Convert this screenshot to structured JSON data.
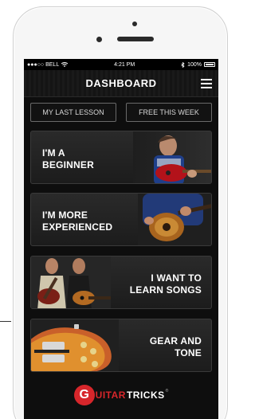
{
  "status_bar": {
    "carrier": "●●●○○ BELL",
    "time": "4:21 PM",
    "battery": "100%"
  },
  "nav": {
    "title": "DASHBOARD"
  },
  "tabs": [
    {
      "label": "MY LAST LESSON"
    },
    {
      "label": "FREE THIS WEEK"
    }
  ],
  "cards": [
    {
      "line1": "I'M A",
      "line2": "BEGINNER"
    },
    {
      "line1": "I'M MORE",
      "line2": "EXPERIENCED"
    },
    {
      "line1": "I WANT TO",
      "line2": "LEARN SONGS"
    },
    {
      "line1": "GEAR AND",
      "line2": "TONE"
    }
  ],
  "logo": {
    "letter": "G",
    "word1": "UITAR",
    "word2": "TRICKS",
    "tm": "®"
  },
  "colors": {
    "brand_red": "#d7262b",
    "screen_bg": "#0e0e0e"
  }
}
